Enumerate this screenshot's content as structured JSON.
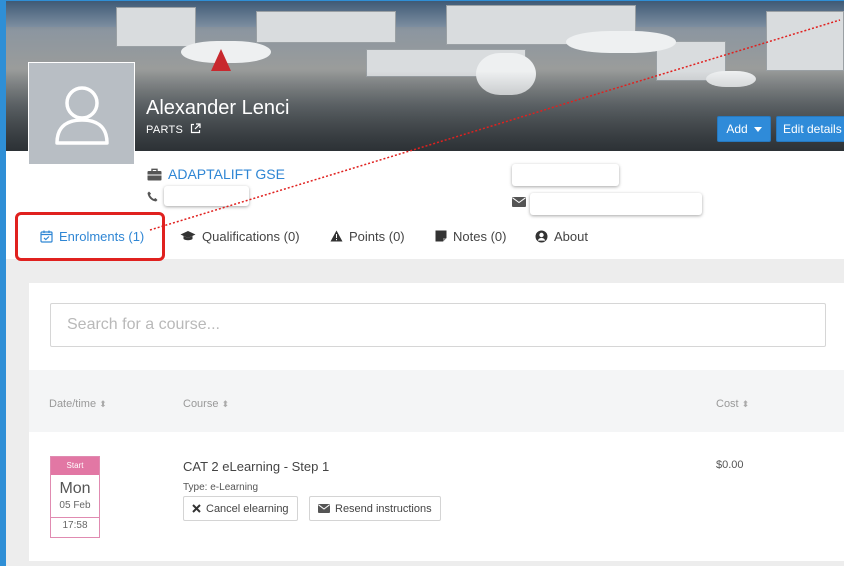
{
  "profile": {
    "name": "Alexander Lenci",
    "org": "PARTS",
    "company": "ADAPTALIFT GSE"
  },
  "actions": {
    "add_label": "Add",
    "edit_label": "Edit details"
  },
  "tabs": [
    {
      "label": "Enrolments (1)",
      "icon": "calendar-check-icon",
      "active": true
    },
    {
      "label": "Qualifications (0)",
      "icon": "graduation-cap-icon",
      "active": false
    },
    {
      "label": "Points (0)",
      "icon": "warning-triangle-icon",
      "active": false
    },
    {
      "label": "Notes (0)",
      "icon": "sticky-note-icon",
      "active": false
    },
    {
      "label": "About",
      "icon": "user-circle-icon",
      "active": false
    }
  ],
  "search": {
    "placeholder": "Search for a course..."
  },
  "table": {
    "headers": [
      "Date/time",
      "Course",
      "Cost"
    ],
    "rows": [
      {
        "badge_label": "Start",
        "day": "Mon",
        "date": "05 Feb",
        "time": "17:58",
        "course": "CAT 2 eLearning - Step 1",
        "type": "Type: e-Learning",
        "cost": "$0.00",
        "buttons": {
          "cancel": "Cancel elearning",
          "resend": "Resend instructions"
        }
      }
    ]
  },
  "colors": {
    "accent": "#2f86d4",
    "highlight": "#e0211f",
    "badge": "#e277a4"
  }
}
